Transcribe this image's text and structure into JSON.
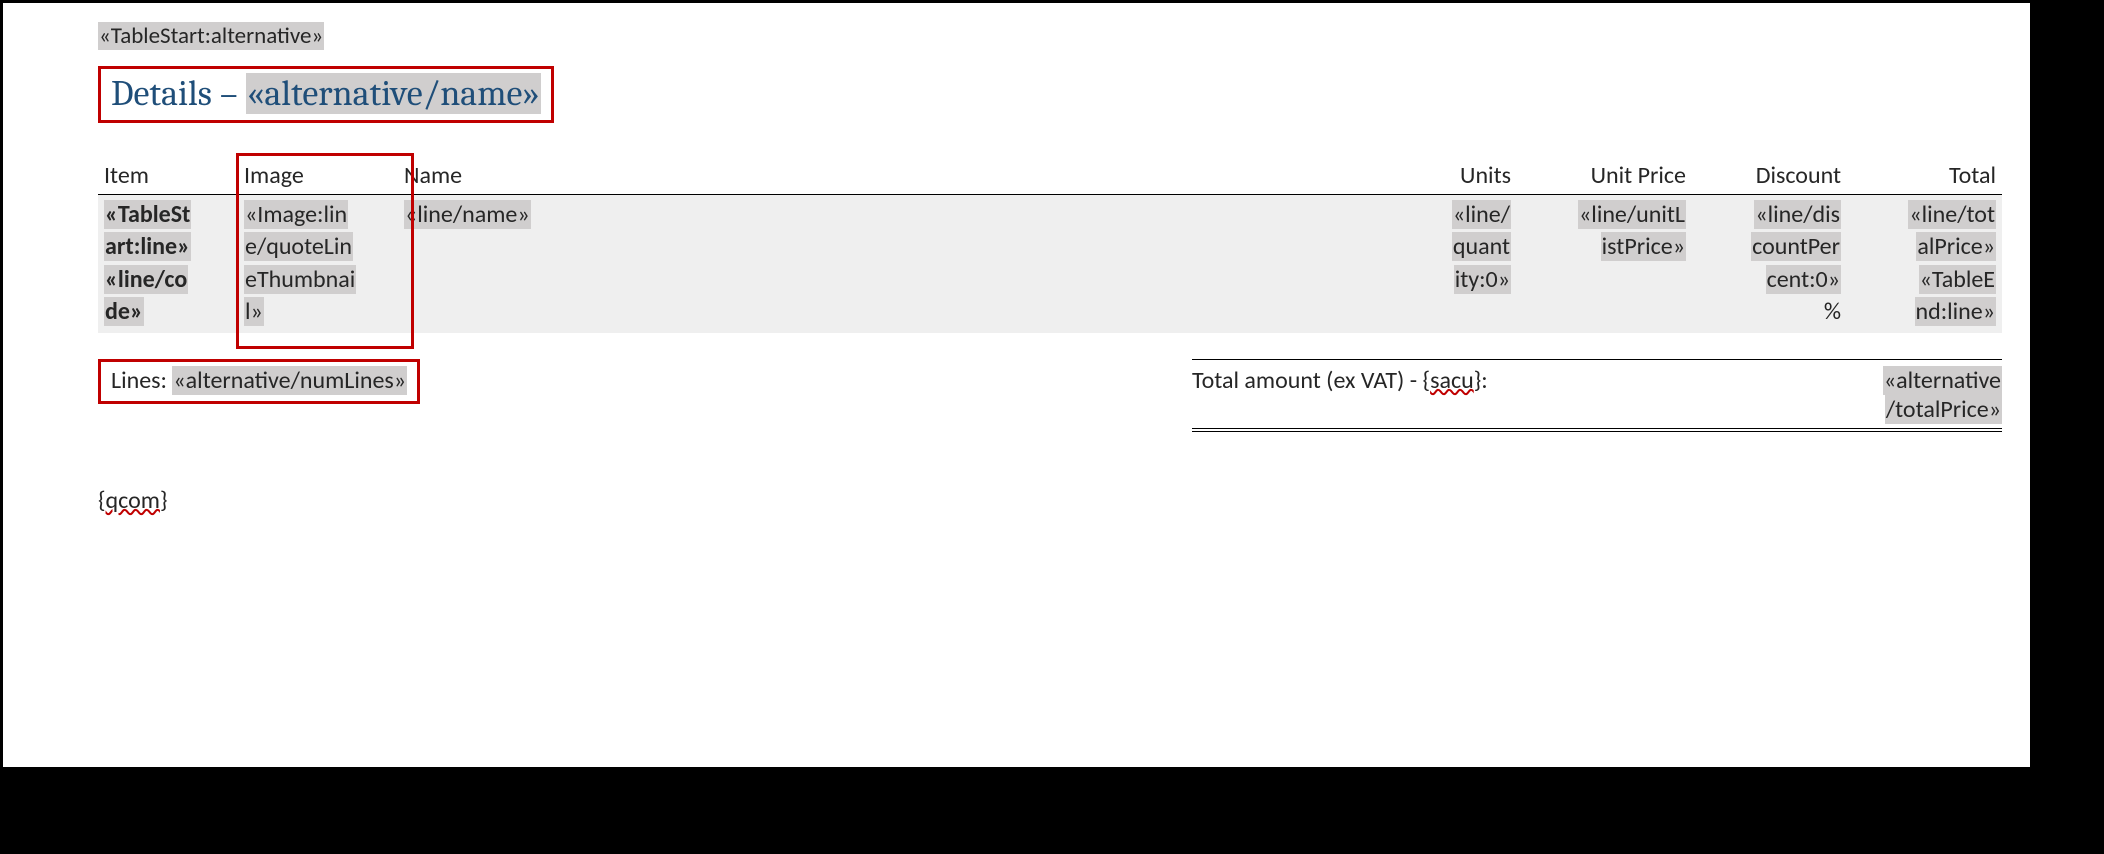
{
  "topMerge": "«TableStart:alternative»",
  "heading": {
    "static": "Details – ",
    "merge": "«alternative/name»"
  },
  "columns": {
    "item": "Item",
    "image": "Image",
    "name": "Name",
    "units": "Units",
    "unitPrice": "Unit Price",
    "discount": "Discount",
    "total": "Total"
  },
  "row": {
    "item": {
      "l1": "«TableSt",
      "l2": "art:line»",
      "l3": "«line/co",
      "l4": "de»"
    },
    "image": {
      "l1": "«Image:lin",
      "l2": "e/quoteLin",
      "l3": "eThumbnai",
      "l4": "l»"
    },
    "name": "«line/name»",
    "units": {
      "l1": "«line/",
      "l2": "quant",
      "l3": "ity:0»"
    },
    "unitPrice": {
      "l1": "«line/unitL",
      "l2": "istPrice»"
    },
    "discount": {
      "l1": "«line/dis",
      "l2": "countPer",
      "l3": "cent:0»",
      "l4": "%"
    },
    "total": {
      "l1": "«line/tot",
      "l2": "alPrice»",
      "l3": "«TableE",
      "l4": "nd:line»"
    }
  },
  "lines": {
    "label": "Lines: ",
    "merge": "«alternative/numLines»"
  },
  "totals": {
    "label_pre": "Total amount (ex VAT) - {",
    "label_squig": "sacu",
    "label_post": "}:",
    "val_l1": "«alternative",
    "val_l2": "/totalPrice»"
  },
  "qcom": {
    "pre": "{",
    "mid": "qcom",
    "post": "}"
  }
}
